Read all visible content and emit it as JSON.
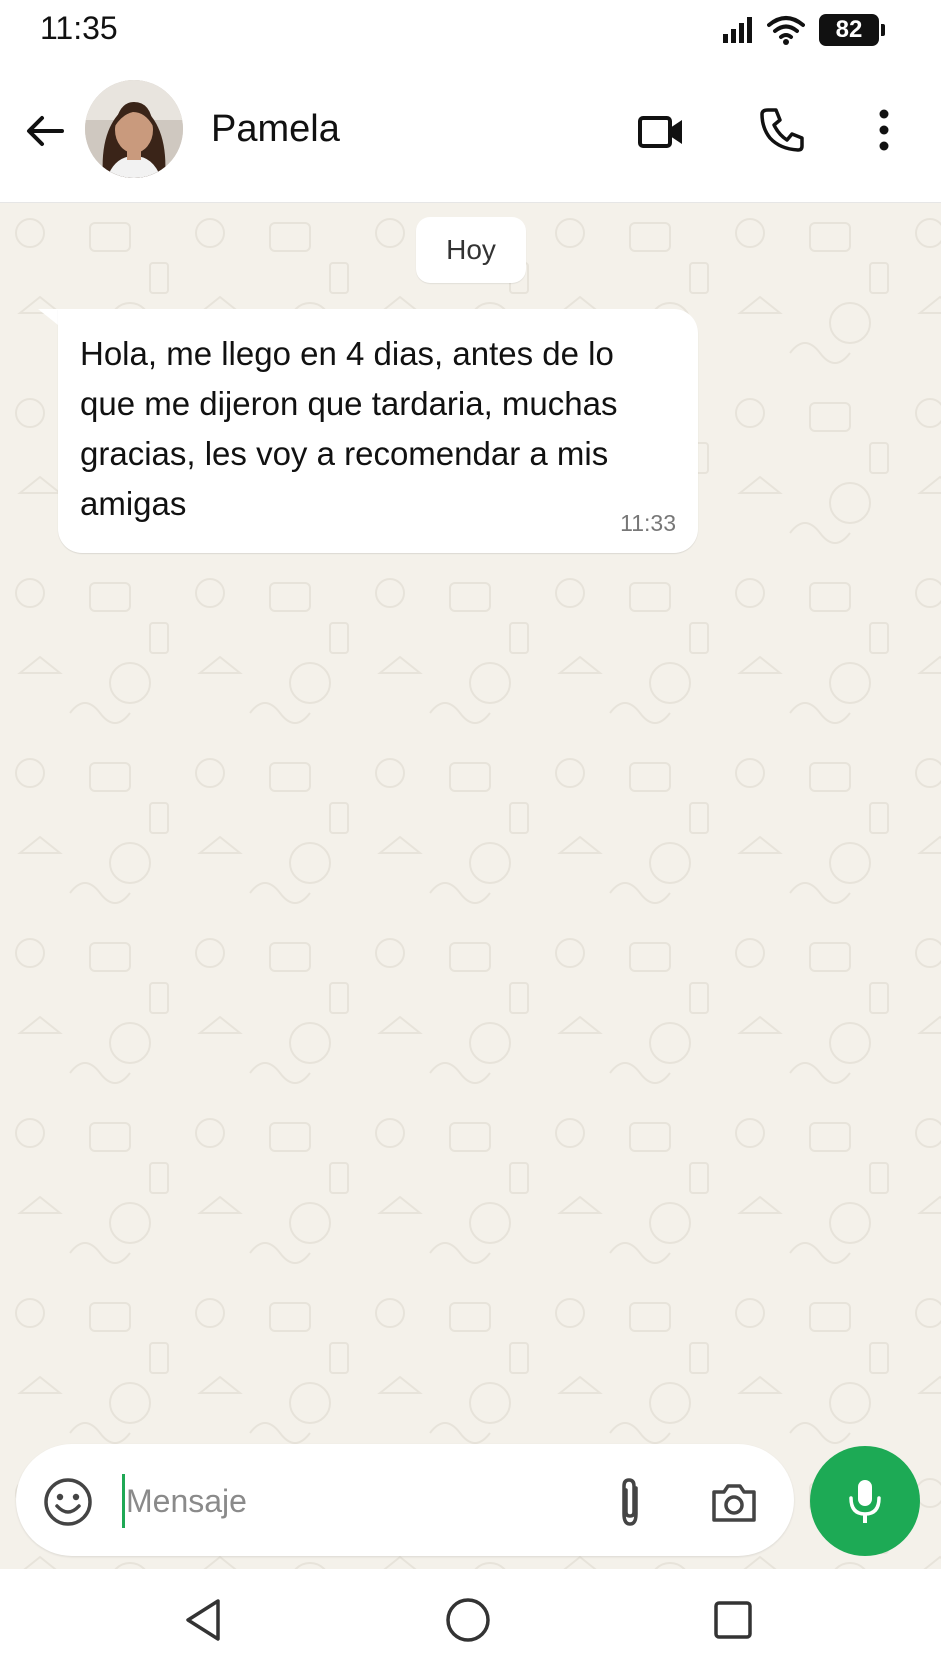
{
  "status_bar": {
    "time": "11:35",
    "battery": "82",
    "icons": [
      "signal-icon",
      "wifi-icon",
      "battery-icon"
    ]
  },
  "header": {
    "contact_name": "Pamela",
    "icons": [
      "back-arrow-icon",
      "avatar",
      "video-call-icon",
      "phone-icon",
      "more-vert-icon"
    ]
  },
  "chat": {
    "date_label": "Hoy",
    "messages": [
      {
        "direction": "incoming",
        "text": "Hola, me llego en 4 dias, antes de lo que me dijeron que tardaria, muchas gracias, les voy a recomendar a mis amigas",
        "time": "11:33"
      }
    ]
  },
  "composer": {
    "placeholder": "Mensaje",
    "value": "",
    "icons": [
      "emoji-icon",
      "attach-icon",
      "camera-icon",
      "mic-icon"
    ]
  },
  "nav_bar": {
    "icons": [
      "nav-back-icon",
      "nav-home-icon",
      "nav-recents-icon"
    ]
  },
  "colors": {
    "accent_green": "#1daa55",
    "chat_background": "#f4f1ea",
    "bubble": "#ffffff"
  }
}
